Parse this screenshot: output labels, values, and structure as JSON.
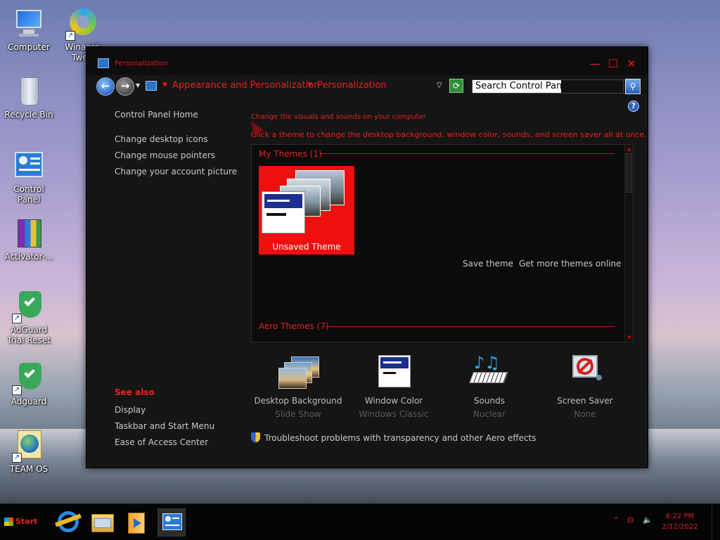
{
  "desktop": {
    "icons": [
      {
        "label": "Computer"
      },
      {
        "label": "Winaero Twea"
      },
      {
        "label": "Recycle Bin"
      },
      {
        "label": "Control Panel"
      },
      {
        "label": "Activator-..."
      },
      {
        "label": "AdGuard Trial Reset"
      },
      {
        "label": "Adguard"
      },
      {
        "label": "TEAM OS"
      }
    ]
  },
  "window": {
    "title": "Personalization",
    "buttons": {
      "minimize": "—",
      "maximize": "☐",
      "close": "✕"
    },
    "breadcrumb": [
      "Appearance and Personalization",
      "Personalization"
    ],
    "search": {
      "placeholder": "Search Control Panel",
      "value": "Search Control Panel"
    },
    "help_label": "?"
  },
  "leftnav": {
    "home": "Control Panel Home",
    "links": [
      "Change desktop icons",
      "Change mouse pointers",
      "Change your account picture"
    ]
  },
  "seealso": {
    "header": "See also",
    "links": [
      "Display",
      "Taskbar and Start Menu",
      "Ease of Access Center"
    ]
  },
  "main": {
    "heading": "Change the visuals and sounds on your computer",
    "subheading": "Click a theme to change the desktop background, window color, sounds, and screen saver all at once.",
    "my_themes": {
      "header": "My Themes (1)",
      "selected_theme": "Unsaved Theme"
    },
    "theme_links": {
      "save": "Save theme",
      "more": "Get more themes online"
    },
    "aero_themes": {
      "header": "Aero Themes (7)"
    },
    "options": [
      {
        "name": "Desktop Background",
        "value": "Slide Show"
      },
      {
        "name": "Window Color",
        "value": "Windows Classic"
      },
      {
        "name": "Sounds",
        "value": "Nuclear"
      },
      {
        "name": "Screen Saver",
        "value": "None"
      }
    ],
    "troubleshoot": "Troubleshoot problems with transparency and other Aero effects"
  },
  "taskbar": {
    "start_label": "Start",
    "apps": [
      "internet-explorer-icon",
      "file-explorer-icon",
      "media-player-icon",
      "control-panel-icon"
    ],
    "clock": {
      "time": "6:22 PM",
      "date": "2/12/2022"
    }
  },
  "colors": {
    "accent": "#e3221e",
    "window_bg": "#151515",
    "tile": "#f00f0f"
  }
}
